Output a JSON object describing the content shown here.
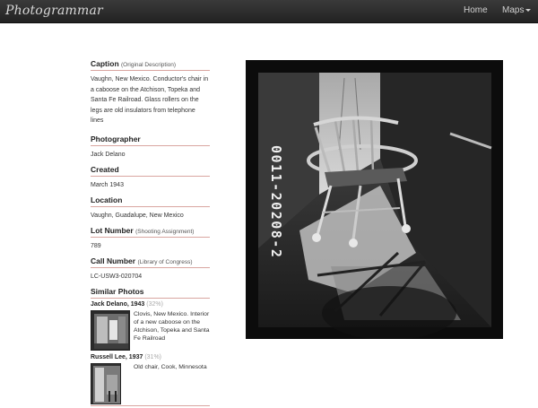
{
  "navbar": {
    "brand": "Photogrammar",
    "home_label": "Home",
    "maps_label": "Maps"
  },
  "caption": {
    "label": "Caption",
    "sub": "(Original Description)",
    "text": "Vaughn, New Mexico. Conductor's chair in a caboose on the Atchison, Topeka and Santa Fe Railroad. Glass rollers on the legs are old insulators from telephone lines"
  },
  "photographer": {
    "label": "Photographer",
    "value": "Jack Delano"
  },
  "created": {
    "label": "Created",
    "value": "March 1943"
  },
  "location": {
    "label": "Location",
    "value": "Vaughn, Guadalupe, New Mexico"
  },
  "lot": {
    "label": "Lot Number",
    "sub": "(Shooting Assignment)",
    "value": "789"
  },
  "call": {
    "label": "Call Number",
    "sub": "(Library of Congress)",
    "value": "LC-USW3-020704"
  },
  "similar": {
    "label": "Similar Photos",
    "items": [
      {
        "title": "Jack Delano, 1943",
        "pct": "(32%)",
        "text": "Clovis, New Mexico. Interior of a new caboose on the Atchison, Topeka and Santa Fe Railroad"
      },
      {
        "title": "Russell Lee, 1937",
        "pct": "(31%)",
        "text": "Old chair, Cook, Minnesota"
      }
    ]
  },
  "photo": {
    "edge_number": "0011-20208-2"
  },
  "colors": {
    "navbar": "#2b2b2b",
    "divider": "#d9a5a0",
    "photo_bg": "#0c0c0c"
  }
}
